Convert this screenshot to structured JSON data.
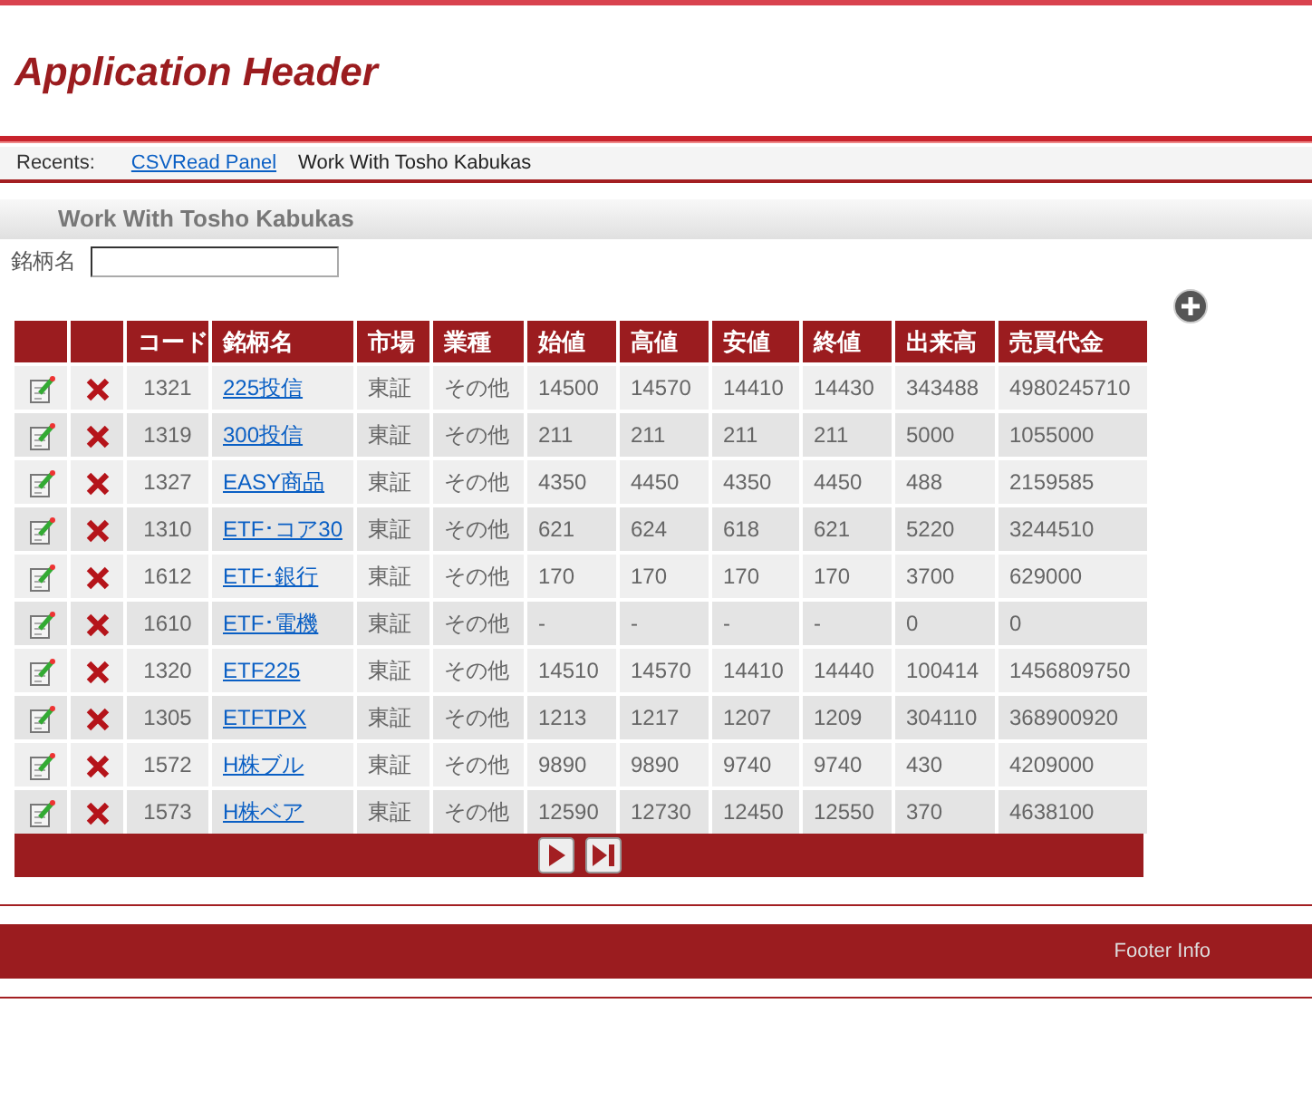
{
  "header": {
    "title": "Application Header"
  },
  "recents": {
    "label": "Recents:",
    "links": [
      {
        "text": "CSVRead Panel",
        "kind": "link"
      },
      {
        "text": "Work With Tosho Kabukas",
        "kind": "current"
      }
    ]
  },
  "panel": {
    "title": "Work With Tosho Kabukas"
  },
  "filter": {
    "label": "銘柄名"
  },
  "table": {
    "columns": [
      "コード",
      "銘柄名",
      "市場",
      "業種",
      "始値",
      "高値",
      "安値",
      "終値",
      "出来高",
      "売買代金"
    ],
    "rows": [
      [
        "1321",
        "225投信",
        "東証",
        "その他",
        "14500",
        "14570",
        "14410",
        "14430",
        "343488",
        "4980245710"
      ],
      [
        "1319",
        "300投信",
        "東証",
        "その他",
        "211",
        "211",
        "211",
        "211",
        "5000",
        "1055000"
      ],
      [
        "1327",
        "EASY商品",
        "東証",
        "その他",
        "4350",
        "4450",
        "4350",
        "4450",
        "488",
        "2159585"
      ],
      [
        "1310",
        "ETF･コア30",
        "東証",
        "その他",
        "621",
        "624",
        "618",
        "621",
        "5220",
        "3244510"
      ],
      [
        "1612",
        "ETF･銀行",
        "東証",
        "その他",
        "170",
        "170",
        "170",
        "170",
        "3700",
        "629000"
      ],
      [
        "1610",
        "ETF･電機",
        "東証",
        "その他",
        "-",
        "-",
        "-",
        "-",
        "0",
        "0"
      ],
      [
        "1320",
        "ETF225",
        "東証",
        "その他",
        "14510",
        "14570",
        "14410",
        "14440",
        "100414",
        "1456809750"
      ],
      [
        "1305",
        "ETFTPX",
        "東証",
        "その他",
        "1213",
        "1217",
        "1207",
        "1209",
        "304110",
        "368900920"
      ],
      [
        "1572",
        "H株ブル",
        "東証",
        "その他",
        "9890",
        "9890",
        "9740",
        "9740",
        "430",
        "4209000"
      ],
      [
        "1573",
        "H株ベア",
        "東証",
        "その他",
        "12590",
        "12730",
        "12450",
        "12550",
        "370",
        "4638100"
      ]
    ]
  },
  "footer": {
    "text": "Footer Info"
  }
}
